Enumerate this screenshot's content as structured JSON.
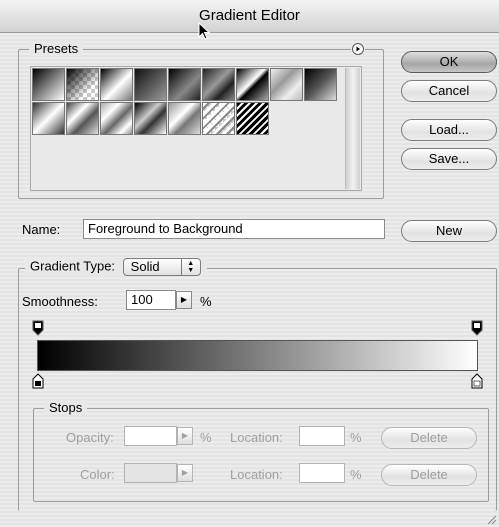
{
  "window": {
    "title": "Gradient Editor"
  },
  "presets": {
    "legend": "Presets",
    "menu_icon": "circle-arrow-icon",
    "swatches": [
      {
        "style": "linear-gradient(135deg,#000 0%,#fff 100%)"
      },
      {
        "style": "checker-fade"
      },
      {
        "style": "linear-gradient(135deg,#000 0%,#fff 55%,#777 100%)"
      },
      {
        "style": "linear-gradient(135deg,#111 0%,#555 50%,#999 100%)"
      },
      {
        "style": "linear-gradient(135deg,#000 0%,#888 60%,#222 100%)"
      },
      {
        "style": "linear-gradient(135deg,#222 0%,#999 45%,#222 70%,#888 100%)"
      },
      {
        "style": "linear-gradient(135deg,#000 0%,#fff 45%,#000 55%,#aaa 100%)"
      },
      {
        "style": "linear-gradient(135deg,#eee 0%,#999 40%,#eee 70%,#bbb 100%)"
      },
      {
        "style": "linear-gradient(135deg,#000 0%,#555 50%,#ddd 100%)"
      },
      {
        "style": "linear-gradient(135deg,#333 0%,#fff 50%,#333 100%)"
      },
      {
        "style": "linear-gradient(135deg,#444 0%,#fff 35%,#555 60%,#ddd 100%)"
      },
      {
        "style": "linear-gradient(135deg,#aaa 0%,#fff 30%,#666 55%,#fff 80%,#888 100%)"
      },
      {
        "style": "linear-gradient(135deg,#000 0%,#ccc 40%,#333 60%,#fff 100%)"
      },
      {
        "style": "linear-gradient(135deg,#999 0%,#fff 40%,#777 60%,#ddd 100%)"
      },
      {
        "style": "stripes-checker"
      },
      {
        "style": "stripes-black"
      }
    ]
  },
  "buttons": {
    "ok": "OK",
    "cancel": "Cancel",
    "load": "Load...",
    "save": "Save...",
    "new": "New"
  },
  "name": {
    "label": "Name:",
    "value": "Foreground to Background"
  },
  "gradient_type": {
    "label": "Gradient Type:",
    "value": "Solid"
  },
  "smoothness": {
    "label": "Smoothness:",
    "value": "100",
    "unit": "%"
  },
  "gradient_bar": {
    "from": "#000000",
    "to": "#ffffff"
  },
  "stops": {
    "legend": "Stops",
    "opacity_label": "Opacity:",
    "opacity_unit": "%",
    "color_label": "Color:",
    "location_label": "Location:",
    "location_unit": "%",
    "delete_label": "Delete"
  }
}
